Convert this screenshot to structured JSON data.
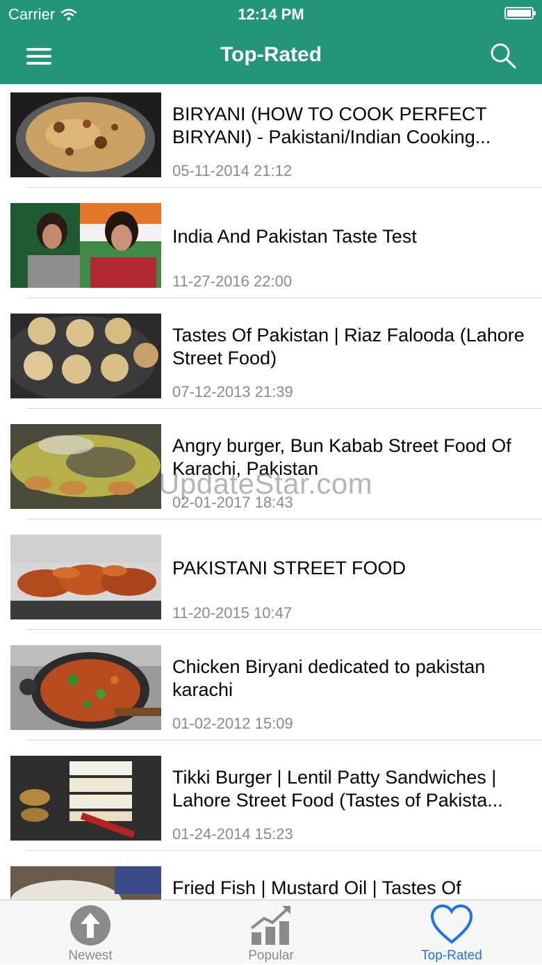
{
  "status_bar": {
    "carrier": "Carrier",
    "time": "12:14 PM"
  },
  "nav": {
    "title": "Top-Rated",
    "menu_icon": "hamburger-menu-icon",
    "search_icon": "search-icon"
  },
  "videos": [
    {
      "title": "BIRYANI (HOW TO COOK PERFECT BIRYANI) - Pakistani/Indian Cooking...",
      "date": "05-11-2014 21:12"
    },
    {
      "title": "India And Pakistan Taste Test",
      "date": "11-27-2016 22:00"
    },
    {
      "title": "Tastes Of Pakistan | Riaz Falooda (Lahore Street Food)",
      "date": "07-12-2013 21:39"
    },
    {
      "title": "Angry burger, Bun Kabab Street Food Of Karachi, Pakistan",
      "date": "02-01-2017 18:43"
    },
    {
      "title": "PAKISTANI STREET FOOD",
      "date": "11-20-2015 10:47"
    },
    {
      "title": "Chicken Biryani dedicated to pakistan karachi",
      "date": "01-02-2012 15:09"
    },
    {
      "title": "Tikki Burger | Lentil Patty Sandwiches | Lahore Street Food (Tastes of Pakista...",
      "date": "01-24-2014 15:23"
    },
    {
      "title": "Fried Fish | Mustard Oil | Tastes Of",
      "date": ""
    }
  ],
  "watermark": "UpdateStar.com",
  "tabs": [
    {
      "label": "Newest",
      "icon": "up-arrow-circle-icon"
    },
    {
      "label": "Popular",
      "icon": "bar-chart-trend-icon"
    },
    {
      "label": "Top-Rated",
      "icon": "heart-icon"
    }
  ],
  "colors": {
    "primary": "#23967a",
    "active_tab": "#1a73e8",
    "inactive_tab": "#8a8a8a",
    "date_text": "#8a8a8a"
  }
}
